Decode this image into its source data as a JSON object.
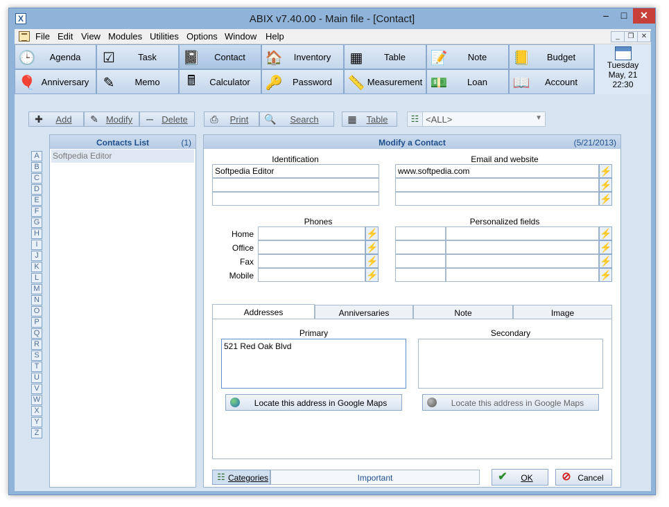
{
  "window": {
    "title": "ABIX v7.40.00  -  Main file - [Contact]",
    "app_icon": "X"
  },
  "menu": [
    "File",
    "Edit",
    "View",
    "Modules",
    "Utilities",
    "Options",
    "Window",
    "Help"
  ],
  "modules_row1": [
    {
      "label": "Agenda",
      "icon": "clock-icon"
    },
    {
      "label": "Task",
      "icon": "checklist-icon"
    },
    {
      "label": "Contact",
      "icon": "address-book-icon"
    },
    {
      "label": "Inventory",
      "icon": "house-icon"
    },
    {
      "label": "Table",
      "icon": "table-icon"
    },
    {
      "label": "Note",
      "icon": "note-icon"
    },
    {
      "label": "Budget",
      "icon": "ledger-icon"
    }
  ],
  "modules_row2": [
    {
      "label": "Anniversary",
      "icon": "balloons-icon"
    },
    {
      "label": "Memo",
      "icon": "memo-icon"
    },
    {
      "label": "Calculator",
      "icon": "calculator-icon"
    },
    {
      "label": "Password",
      "icon": "password-icon"
    },
    {
      "label": "Measurement",
      "icon": "ruler-icon"
    },
    {
      "label": "Loan",
      "icon": "money-icon"
    },
    {
      "label": "Account",
      "icon": "account-icon"
    }
  ],
  "date": {
    "weekday": "Tuesday",
    "day": "May, 21",
    "time": "22:30"
  },
  "toolbar": {
    "add": "Add",
    "modify": "Modify",
    "delete": "Delete",
    "print": "Print",
    "search": "Search",
    "table": "Table",
    "category_filter": "<ALL>"
  },
  "contacts_list": {
    "title": "Contacts List",
    "count": "(1)",
    "items": [
      "Softpedia Editor"
    ]
  },
  "alphabet": [
    "A",
    "B",
    "C",
    "D",
    "E",
    "F",
    "G",
    "H",
    "I",
    "J",
    "K",
    "L",
    "M",
    "N",
    "O",
    "P",
    "Q",
    "R",
    "S",
    "T",
    "U",
    "V",
    "W",
    "X",
    "Y",
    "Z"
  ],
  "form": {
    "title": "Modify a Contact",
    "date": "(5/21/2013)",
    "identification_label": "Identification",
    "identification": [
      "Softpedia Editor",
      "",
      ""
    ],
    "email_label": "Email and website",
    "email": [
      "www.softpedia.com",
      "",
      ""
    ],
    "phones_label": "Phones",
    "phones": [
      {
        "label": "Home",
        "value": ""
      },
      {
        "label": "Office",
        "value": ""
      },
      {
        "label": "Fax",
        "value": ""
      },
      {
        "label": "Mobile",
        "value": ""
      }
    ],
    "personalized_label": "Personalized fields",
    "tabs": [
      "Addresses",
      "Anniversaries",
      "Note",
      "Image"
    ],
    "primary_label": "Primary",
    "secondary_label": "Secondary",
    "primary_address": "521 Red Oak Blvd",
    "secondary_address": "",
    "locate_primary": "Locate this address in Google Maps",
    "locate_secondary": "Locate this address in Google Maps",
    "categories_btn": "Categories",
    "category_value": "Important",
    "ok": "OK",
    "cancel": "Cancel"
  }
}
